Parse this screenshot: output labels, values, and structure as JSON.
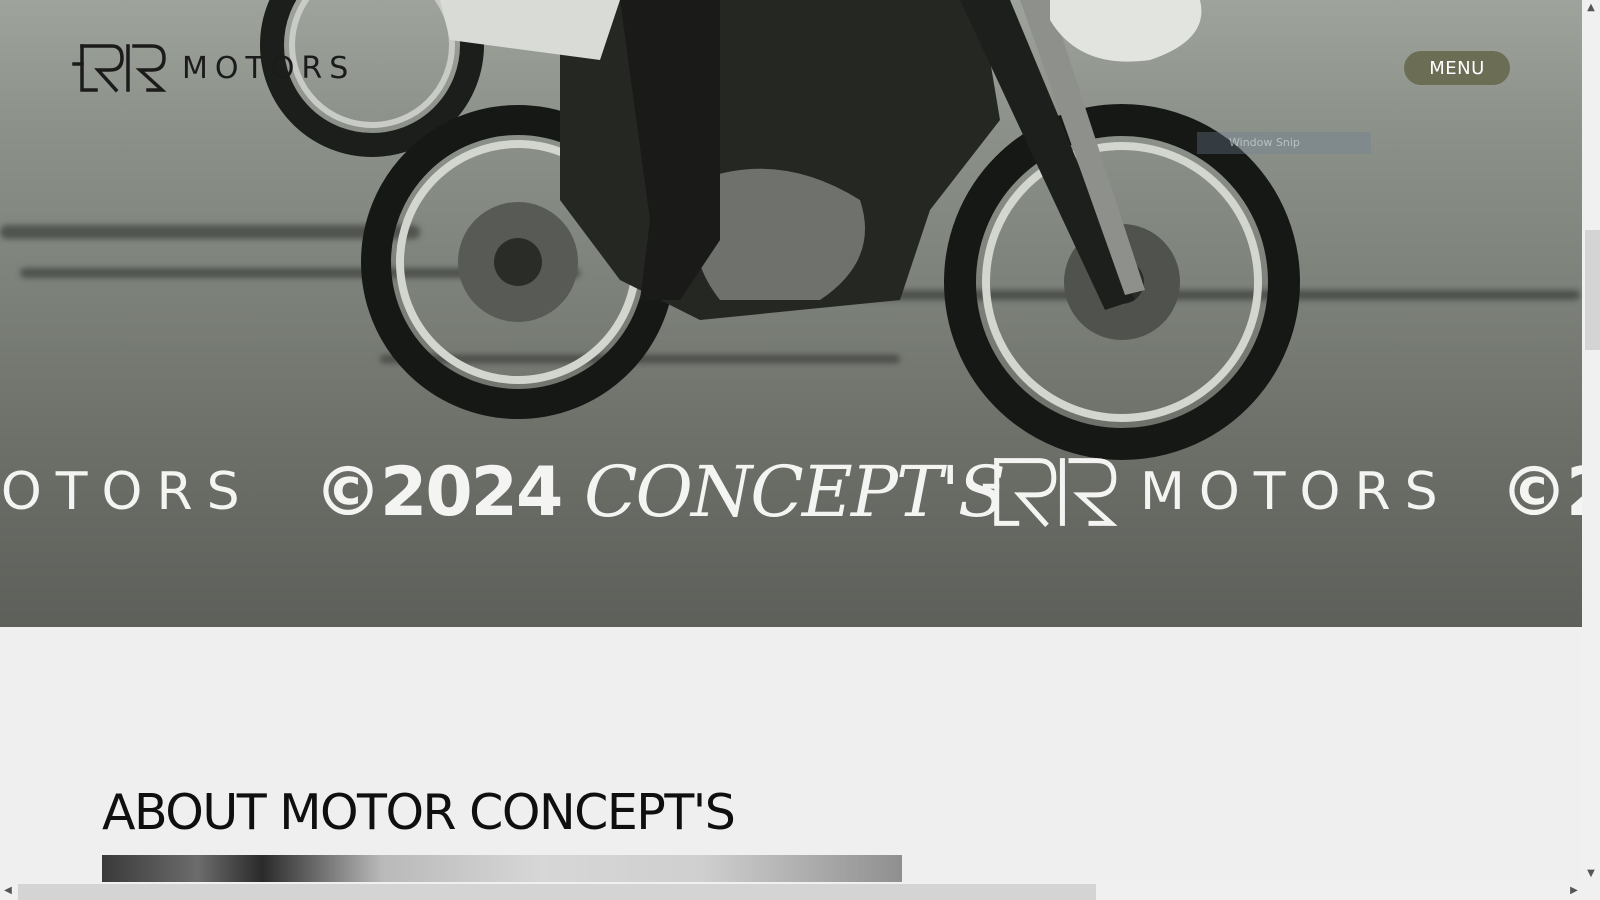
{
  "header": {
    "logo_word": "MOTORS",
    "menu_label": "MENU"
  },
  "overlay": {
    "window_snip_label": "Window Snip"
  },
  "marquee": {
    "motors": "MOTORS",
    "year": "©2024",
    "concept": "CONCEPT'S"
  },
  "about": {
    "title": "ABOUT MOTOR CONCEPT'S"
  },
  "colors": {
    "menu_bg": "#6b6e55",
    "page_bg": "#efefef"
  }
}
